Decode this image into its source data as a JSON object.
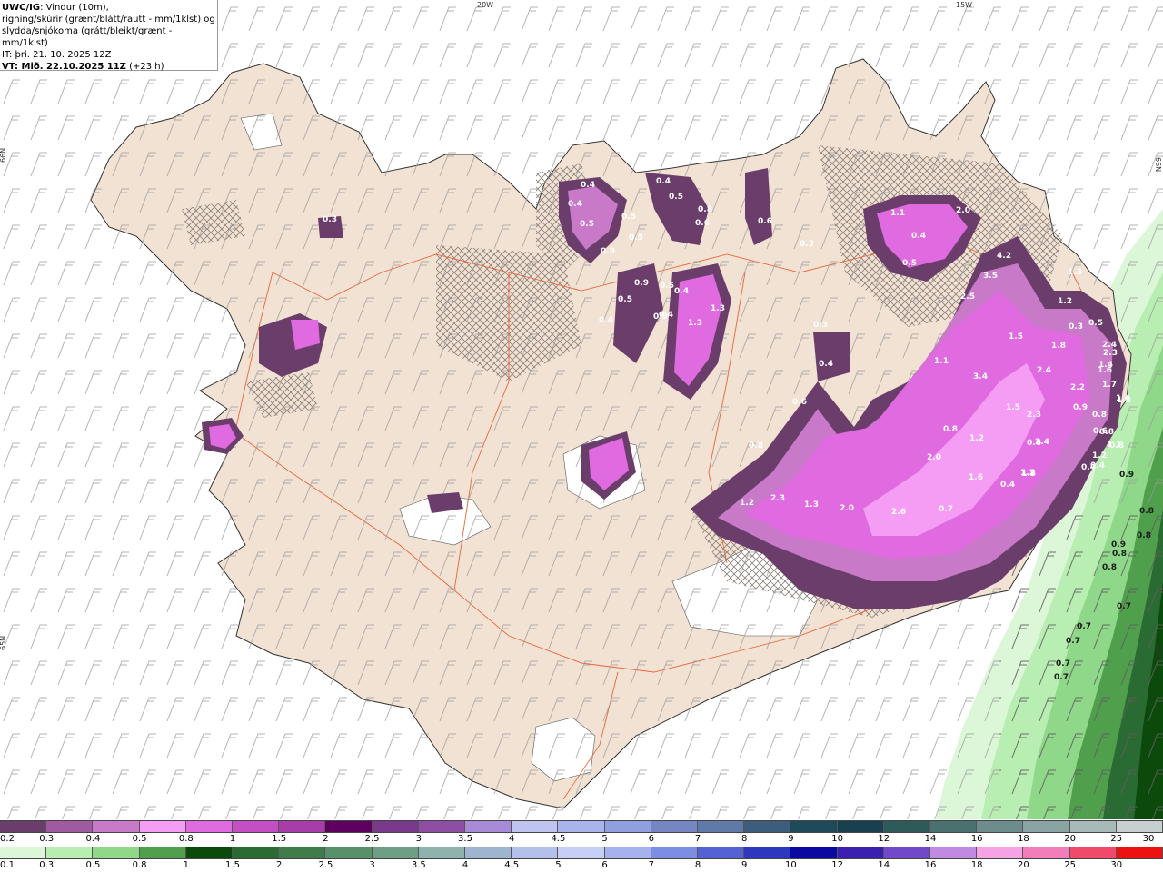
{
  "header": {
    "model": "UWC/IG",
    "line1_rest": ": Vindur (10m),",
    "line2": "rigning/skúrir (grænt/blátt/rautt - mm/1klst) og",
    "line3": "slydda/snjókoma (grátt/bleikt/grænt - mm/1klst)",
    "init_time": "IT: þri. 21. 10. 2025 12Z",
    "valid_time": "VT: Mið. 22.10.2025 11Z",
    "lead": "(+23 h)"
  },
  "graticule_labels": [
    "20W",
    "15W",
    "66N",
    "66N",
    "65N",
    "65N"
  ],
  "precip_labels": [
    "0.4",
    "0.4",
    "0.5",
    "0.5",
    "0.5",
    "0.9",
    "1.3",
    "0.3",
    "0.5",
    "0.8",
    "0.6",
    "0.6",
    "0.4",
    "0.3",
    "1.1",
    "0.4",
    "2.0",
    "0.5",
    "4.2",
    "3.5",
    "2.5",
    "0.3",
    "0.4",
    "0.5",
    "0.9",
    "0.4",
    "0.9",
    "0.5",
    "0.4",
    "1.3",
    "0.4",
    "1.1",
    "1.2",
    "1.3",
    "0.3",
    "0.5",
    "2.4",
    "2.3",
    "1.8",
    "1.5",
    "2.4",
    "1.6",
    "1.4",
    "3.4",
    "2.2",
    "1.8",
    "1.7",
    "1.4",
    "1.2",
    "0.4",
    "0.9",
    "1.5",
    "0.8",
    "0.8",
    "0.6",
    "2.3",
    "0.6",
    "2.4",
    "1.2",
    "0.8",
    "0.6",
    "1.5",
    "1.2",
    "0.8",
    "0.8",
    "2.0",
    "1.6",
    "0.4",
    "1.2",
    "0.4",
    "1.1",
    "1.2",
    "2.3",
    "1.3",
    "2.0",
    "2.6",
    "0.7",
    "0.9",
    "0.8",
    "0.8",
    "0.9",
    "0.8",
    "0.8",
    "0.7",
    "0.7",
    "0.7",
    "0.7",
    "0.7"
  ],
  "legend": {
    "snow_labels": [
      "0.2",
      "0.3",
      "0.4",
      "0.5",
      "0.8",
      "1",
      "1.5",
      "2",
      "2.5",
      "3",
      "3.5",
      "4",
      "4.5",
      "5",
      "6",
      "7",
      "8",
      "9",
      "10",
      "12",
      "14",
      "16",
      "18",
      "20",
      "25",
      "30"
    ],
    "snow_colors": [
      "#6a3d6a",
      "#a05aa0",
      "#c879c8",
      "#f59df5",
      "#e06ae0",
      "#c44fc4",
      "#a83ca8",
      "#5e005e",
      "#7a3a8c",
      "#8e4fa3",
      "#a78bd6",
      "#bfc3f0",
      "#a9b4ec",
      "#8fa0de",
      "#7487c2",
      "#5f7aa8",
      "#3d5d7c",
      "#1f4a5a",
      "#1a3f4f",
      "#2f5a5a",
      "#4a7070",
      "#6d8c8c",
      "#8aa4a4",
      "#a8b9b9",
      "#c6d0d0"
    ],
    "rain_labels": [
      "0.1",
      "0.3",
      "0.5",
      "0.8",
      "1",
      "1.5",
      "2",
      "2.5",
      "3",
      "3.5",
      "4",
      "4.5",
      "5",
      "6",
      "7",
      "8",
      "9",
      "10",
      "12",
      "14",
      "16",
      "18",
      "20",
      "25",
      "30"
    ],
    "rain_colors": [
      "#dbf7d8",
      "#b8eeb2",
      "#8fd889",
      "#4f9f4c",
      "#0b4a0b",
      "#2a6a33",
      "#3f7c4a",
      "#58906a",
      "#6f9e86",
      "#8fb3ac",
      "#9fb4cf",
      "#b3c1ea",
      "#c7cff7",
      "#a5b2ee",
      "#7c8ee3",
      "#5563d2",
      "#2d38bf",
      "#0a0aa0",
      "#3a1fb0",
      "#7048c8",
      "#c08ae3",
      "#f6a3e6",
      "#f27dbb",
      "#f04a6a",
      "#ee1111"
    ]
  },
  "colors": {
    "land": "#f2e2d3",
    "sea": "#ffffff",
    "roads": "#e8663a",
    "wind_barb": "#8a8a8a",
    "precip_low": "#6a3d6a",
    "precip_mid": "#e06ae0",
    "precip_high": "#f59df5",
    "rain_green": "#4f9f4c"
  }
}
